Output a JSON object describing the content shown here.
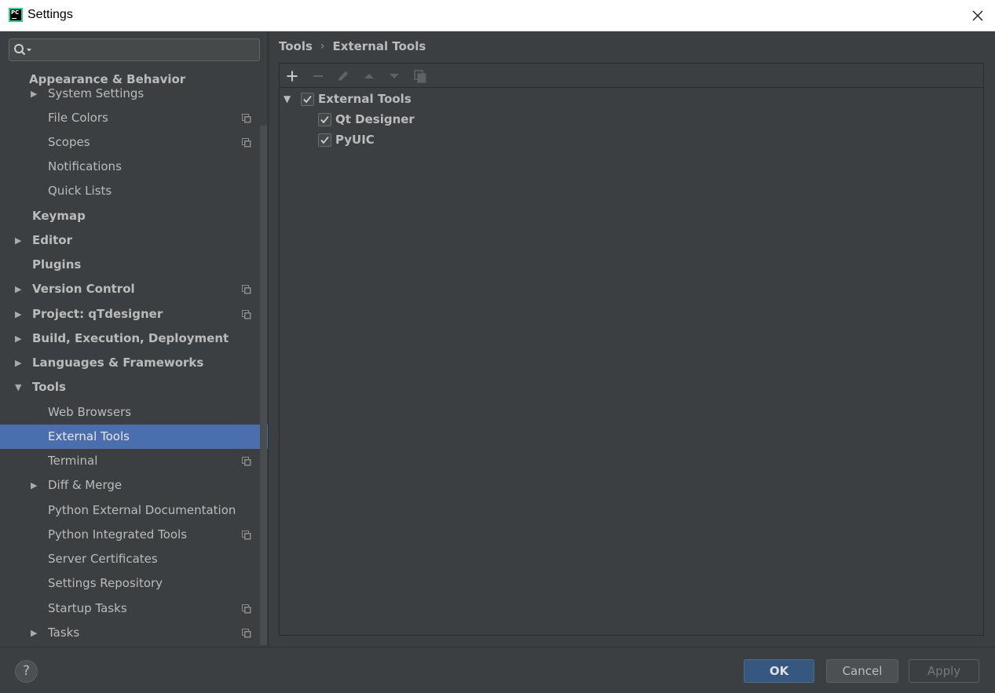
{
  "window": {
    "title": "Settings",
    "app_icon": "pycharm-icon"
  },
  "search": {
    "placeholder": "",
    "value": ""
  },
  "sidebar": {
    "items": [
      {
        "label": "Appearance & Behavior",
        "level": 0,
        "bold": true,
        "arrow": "none"
      },
      {
        "label": "System Settings",
        "level": 1,
        "bold": false,
        "arrow": "right"
      },
      {
        "label": "File Colors",
        "level": 1,
        "bold": false,
        "arrow": "none",
        "project_icon": true
      },
      {
        "label": "Scopes",
        "level": 1,
        "bold": false,
        "arrow": "none",
        "project_icon": true
      },
      {
        "label": "Notifications",
        "level": 1,
        "bold": false,
        "arrow": "none"
      },
      {
        "label": "Quick Lists",
        "level": 1,
        "bold": false,
        "arrow": "none"
      },
      {
        "label": "Keymap",
        "level": 0,
        "bold": true,
        "arrow": "none"
      },
      {
        "label": "Editor",
        "level": 0,
        "bold": true,
        "arrow": "right"
      },
      {
        "label": "Plugins",
        "level": 0,
        "bold": true,
        "arrow": "none"
      },
      {
        "label": "Version Control",
        "level": 0,
        "bold": true,
        "arrow": "right",
        "project_icon": true
      },
      {
        "label": "Project: qTdesigner",
        "level": 0,
        "bold": true,
        "arrow": "right",
        "project_icon": true
      },
      {
        "label": "Build, Execution, Deployment",
        "level": 0,
        "bold": true,
        "arrow": "right"
      },
      {
        "label": "Languages & Frameworks",
        "level": 0,
        "bold": true,
        "arrow": "right"
      },
      {
        "label": "Tools",
        "level": 0,
        "bold": true,
        "arrow": "down"
      },
      {
        "label": "Web Browsers",
        "level": 1,
        "bold": false,
        "arrow": "none"
      },
      {
        "label": "External Tools",
        "level": 1,
        "bold": false,
        "arrow": "none",
        "selected": true
      },
      {
        "label": "Terminal",
        "level": 1,
        "bold": false,
        "arrow": "none",
        "project_icon": true
      },
      {
        "label": "Diff & Merge",
        "level": 1,
        "bold": false,
        "arrow": "right"
      },
      {
        "label": "Python External Documentation",
        "level": 1,
        "bold": false,
        "arrow": "none"
      },
      {
        "label": "Python Integrated Tools",
        "level": 1,
        "bold": false,
        "arrow": "none",
        "project_icon": true
      },
      {
        "label": "Server Certificates",
        "level": 1,
        "bold": false,
        "arrow": "none"
      },
      {
        "label": "Settings Repository",
        "level": 1,
        "bold": false,
        "arrow": "none"
      },
      {
        "label": "Startup Tasks",
        "level": 1,
        "bold": false,
        "arrow": "none",
        "project_icon": true
      },
      {
        "label": "Tasks",
        "level": 1,
        "bold": false,
        "arrow": "right",
        "project_icon": true
      }
    ]
  },
  "breadcrumb": {
    "parent": "Tools",
    "separator": "›",
    "current": "External Tools"
  },
  "toolbar": {
    "buttons": [
      "add-icon",
      "remove-icon",
      "edit-icon",
      "move-up-icon",
      "move-down-icon",
      "copy-icon"
    ]
  },
  "tools_tree": {
    "group": {
      "label": "External Tools",
      "checked": true,
      "expanded": true
    },
    "items": [
      {
        "label": "Qt Designer",
        "checked": true
      },
      {
        "label": "PyUIC",
        "checked": true
      }
    ]
  },
  "footer": {
    "help_label": "?",
    "ok_label": "OK",
    "cancel_label": "Cancel",
    "apply_label": "Apply"
  },
  "colors": {
    "background": "#3c3f41",
    "selection": "#4b6eaf",
    "ok_button": "#365880",
    "text": "#bbbbbb"
  }
}
